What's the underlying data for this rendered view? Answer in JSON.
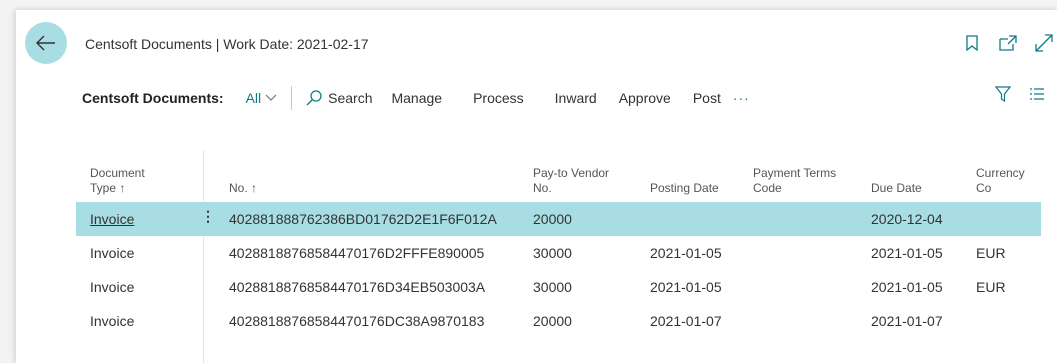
{
  "window": {
    "title": "Centsoft Documents | Work Date: 2021-02-17"
  },
  "icons": {
    "back": "arrow-left-icon",
    "bookmark": "bookmark-icon",
    "open_new": "open-in-new-window-icon",
    "expand": "expand-icon",
    "search": "search-icon",
    "filter": "filter-icon",
    "list": "list-view-icon",
    "more": "more-options-icon",
    "chevron": "chevron-down-icon"
  },
  "actionbar": {
    "page_name": "Centsoft Documents:",
    "filter_label": "All",
    "search_label": "Search",
    "actions": [
      "Manage",
      "Process",
      "Inward",
      "Approve",
      "Post"
    ],
    "more_label": "···"
  },
  "table": {
    "headers": {
      "doc_type_1": "Document",
      "doc_type_2": "Type ↑",
      "no": "No. ↑",
      "vendor_1": "Pay-to Vendor",
      "vendor_2": "No.",
      "posting_date": "Posting Date",
      "terms_1": "Payment Terms",
      "terms_2": "Code",
      "due_date": "Due Date",
      "currency": "Currency Co"
    },
    "rows": [
      {
        "doc_type": "Invoice",
        "no": "402881888762386BD01762D2E1F6F012A",
        "vendor": "20000",
        "posting_date": "",
        "terms": "",
        "due_date": "2020-12-04",
        "currency": ""
      },
      {
        "doc_type": "Invoice",
        "no": "402881887685844701 76D2FFFE890005",
        "vendor": "30000",
        "posting_date": "2021-01-05",
        "terms": "",
        "due_date": "2021-01-05",
        "currency": "EUR"
      },
      {
        "doc_type": "Invoice",
        "no": "402881887685844701 76D34EB503003A",
        "vendor": "30000",
        "posting_date": "2021-01-05",
        "terms": "",
        "due_date": "2021-01-05",
        "currency": "EUR"
      },
      {
        "doc_type": "Invoice",
        "no": "402881887685844701 76DC38A9870183",
        "vendor": "20000",
        "posting_date": "2021-01-07",
        "terms": "",
        "due_date": "2021-01-07",
        "currency": ""
      }
    ],
    "row_menu": "⋮"
  },
  "colors": {
    "accent": "#0e7c86",
    "selected_row": "#a8dde3"
  }
}
